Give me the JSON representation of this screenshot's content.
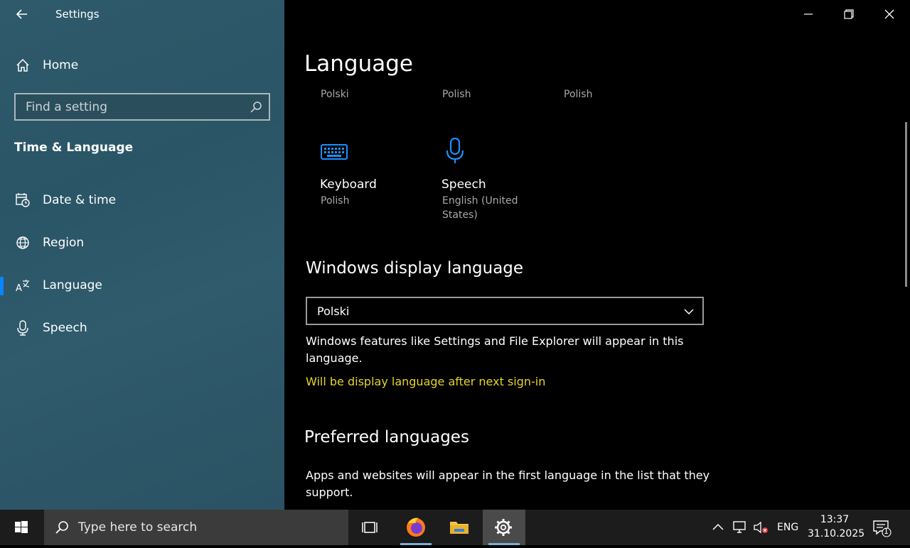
{
  "window": {
    "title": "Settings"
  },
  "sidebar": {
    "home_label": "Home",
    "search_placeholder": "Find a setting",
    "section_title": "Time & Language",
    "items": [
      {
        "label": "Date & time",
        "icon": "calendar-clock-icon"
      },
      {
        "label": "Region",
        "icon": "globe-icon"
      },
      {
        "label": "Language",
        "icon": "language-icon",
        "active": true
      },
      {
        "label": "Speech",
        "icon": "microphone-icon"
      }
    ]
  },
  "main": {
    "page_title": "Language",
    "top_row": [
      "Polski",
      "Polish",
      "Polish"
    ],
    "tiles": [
      {
        "label": "Keyboard",
        "sub": "Polish",
        "icon": "keyboard-icon"
      },
      {
        "label": "Speech",
        "sub_line1": "English (United",
        "sub_line2": "States)",
        "icon": "microphone-icon"
      }
    ],
    "display_language": {
      "heading": "Windows display language",
      "selected": "Polski",
      "description": "Windows features like Settings and File Explorer will appear in this language.",
      "note": "Will be display language after next sign-in"
    },
    "preferred": {
      "heading": "Preferred languages",
      "description": "Apps and websites will appear in the first language in the list that they support."
    }
  },
  "taskbar": {
    "search_placeholder": "Type here to search",
    "lang": "ENG",
    "time": "13:37",
    "date": "31.10.2025",
    "notification_count": "1"
  },
  "colors": {
    "accent": "#0a84ff",
    "note": "#e6d42a",
    "sidebar": "#2f5a6b"
  }
}
